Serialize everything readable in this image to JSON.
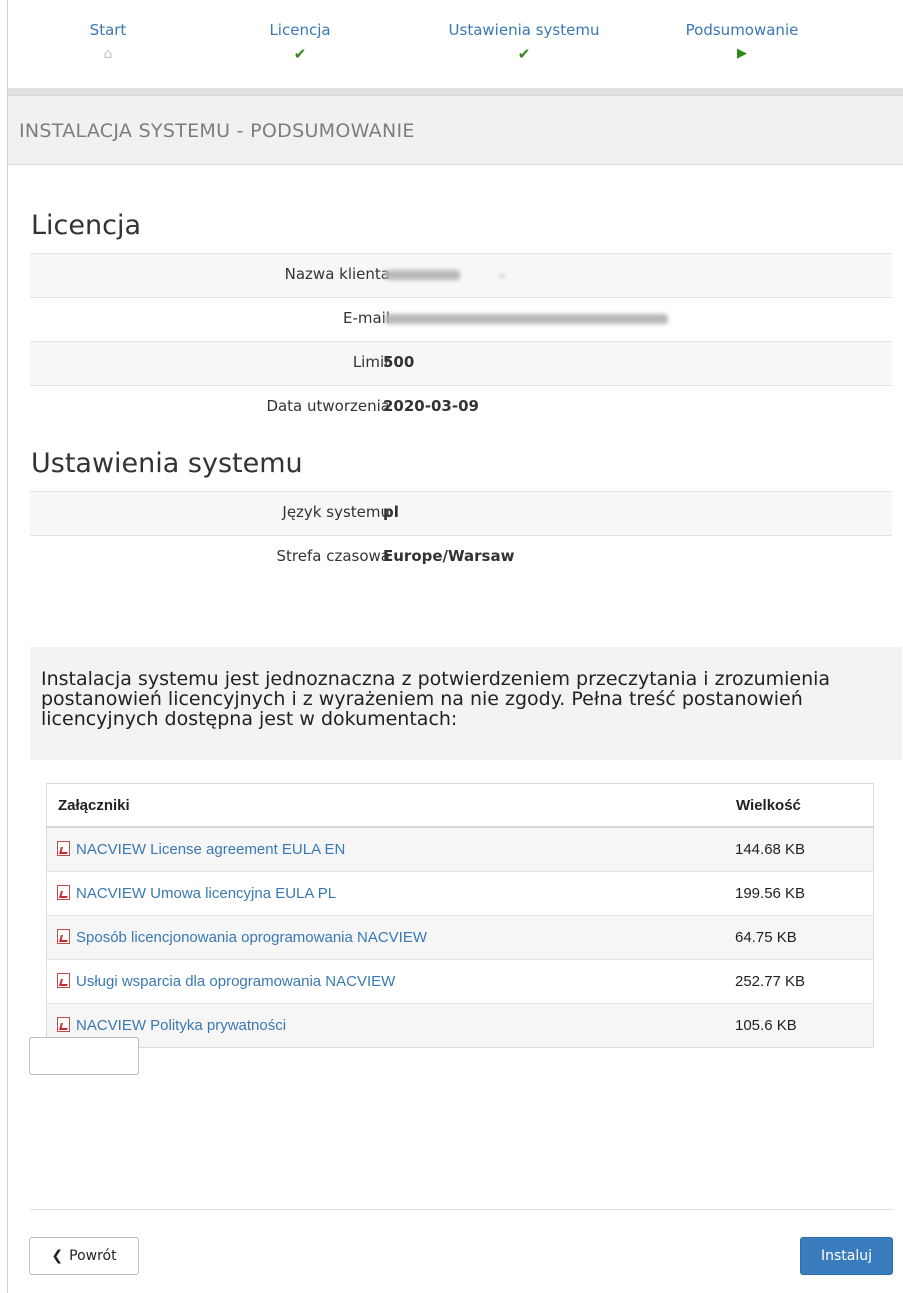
{
  "steps": [
    {
      "label": "Start",
      "icon": "home-icon"
    },
    {
      "label": "Licencja",
      "icon": "check-icon"
    },
    {
      "label": "Ustawienia systemu",
      "icon": "check-icon"
    },
    {
      "label": "Podsumowanie",
      "icon": "play-icon"
    }
  ],
  "page_title": "INSTALACJA SYSTEMU - PODSUMOWANIE",
  "license": {
    "title": "Licencja",
    "rows": [
      {
        "label": "Nazwa klienta",
        "value": ""
      },
      {
        "label": "E-mail",
        "value": ""
      },
      {
        "label": "Limit",
        "value": "500"
      },
      {
        "label": "Data utworzenia",
        "value": "2020-03-09"
      }
    ]
  },
  "settings": {
    "title": "Ustawienia systemu",
    "rows": [
      {
        "label": "Język systemu",
        "value": "pl"
      },
      {
        "label": "Strefa czasowa",
        "value": "Europe/Warsaw"
      }
    ]
  },
  "notice": "Instalacja systemu jest jednoznaczna z potwierdzeniem przeczytania i zrozumienia postanowień licencyjnych i z wyrażeniem na nie zgody. Pełna treść postanowień licencyjnych dostępna jest w dokumentach:",
  "attachments": {
    "col_name": "Załączniki",
    "col_size": "Wielkość",
    "rows": [
      {
        "name": "NACVIEW License agreement EULA EN",
        "size": "144.68 KB"
      },
      {
        "name": "NACVIEW Umowa licencyjna EULA PL",
        "size": "199.56 KB"
      },
      {
        "name": "Sposób licencjonowania oprogramowania NACVIEW",
        "size": "64.75 KB"
      },
      {
        "name": "Usługi wsparcia dla oprogramowania NACVIEW",
        "size": "252.77 KB"
      },
      {
        "name": "NACVIEW Polityka prywatności",
        "size": "105.6 KB"
      }
    ]
  },
  "buttons": {
    "back_label": "Powrót",
    "install_label": "Instaluj"
  },
  "colors": {
    "link": "#3a78b5",
    "check": "#2e8a16",
    "primary_button": "#3a7dbe"
  }
}
